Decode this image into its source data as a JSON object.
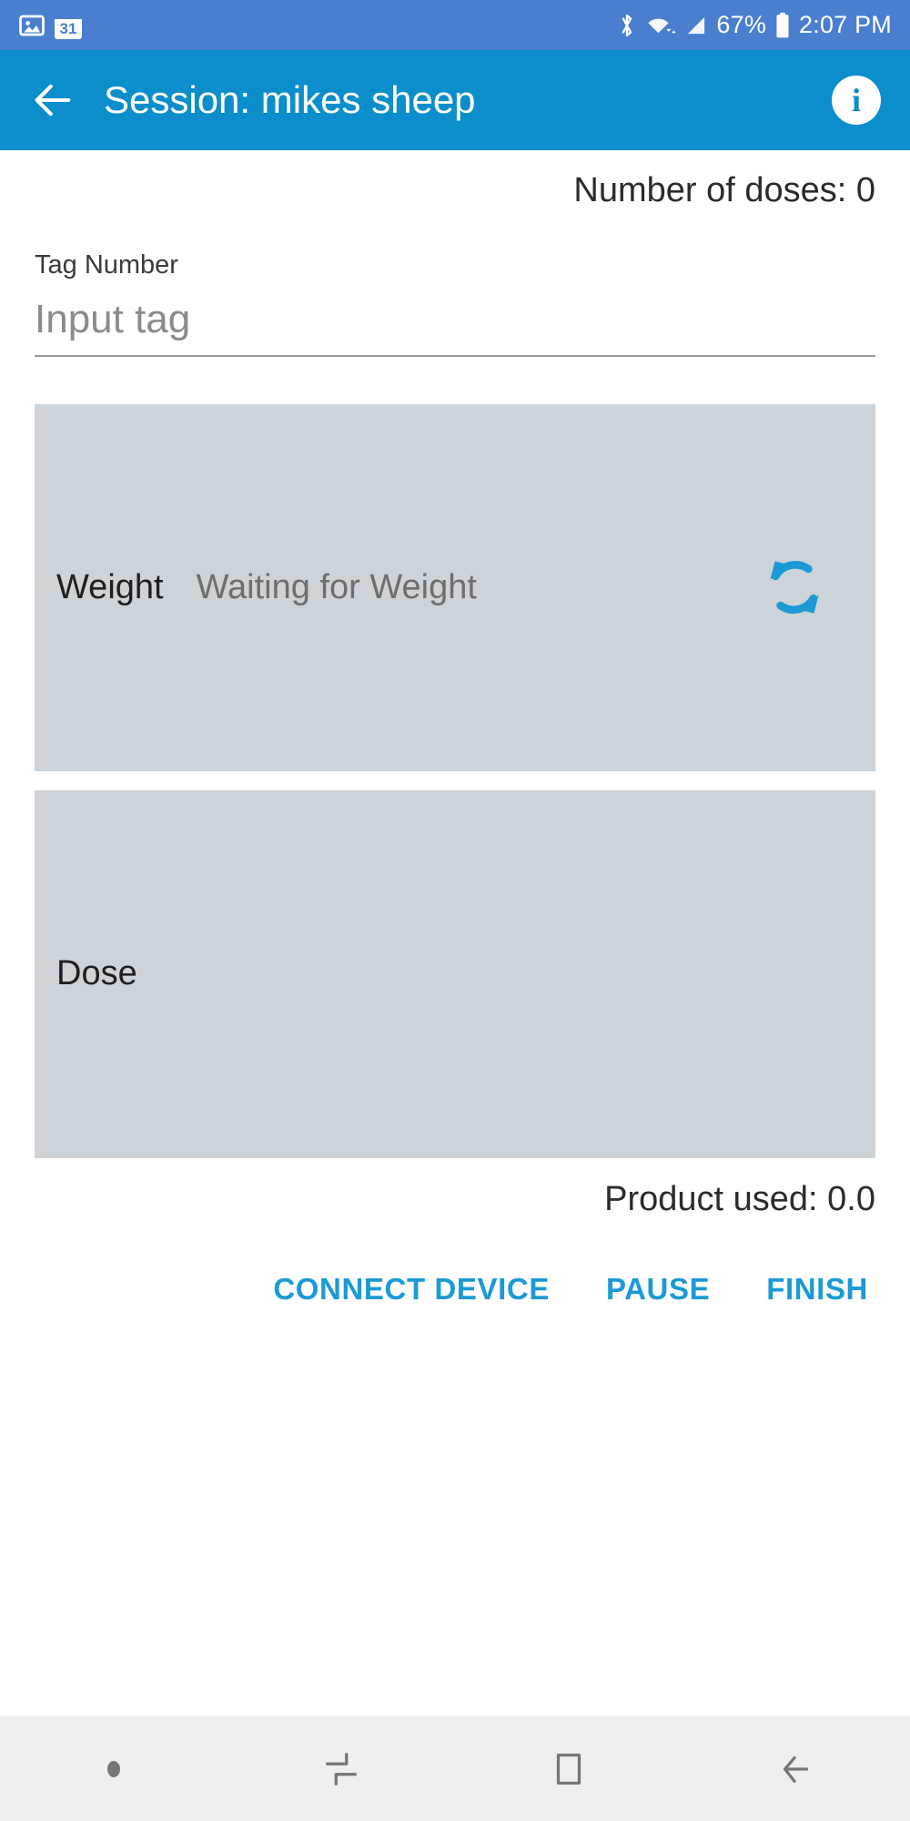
{
  "status_bar": {
    "left_icons": [
      "image-icon",
      "calendar-icon"
    ],
    "calendar_day": "31",
    "right_icons": [
      "bluetooth-icon",
      "wifi-icon",
      "cell-signal-icon",
      "battery-icon"
    ],
    "battery_percent": "67%",
    "time": "2:07 PM",
    "background_color": "#4a7fd0"
  },
  "app_bar": {
    "back_icon": "back-arrow-icon",
    "title": "Session: mikes sheep",
    "info_icon": "info-icon",
    "info_glyph": "i",
    "background_color": "#0b8ecb"
  },
  "main": {
    "doses_text": "Number of doses: 0",
    "tag_label": "Tag Number",
    "tag_value": "",
    "tag_placeholder": "Input tag",
    "weight_panel": {
      "label": "Weight",
      "status": "Waiting for Weight",
      "refresh_icon": "refresh-sync-icon",
      "panel_color": "#ccd3d9",
      "icon_color": "#1b9ad6"
    },
    "dose_panel": {
      "label": "Dose",
      "value": "",
      "panel_color": "#ccd3d9"
    },
    "product_used_text": "Product used: 0.0"
  },
  "actions": {
    "connect_device": "CONNECT DEVICE",
    "pause": "PAUSE",
    "finish": "FINISH",
    "accent_color": "#1b9ad6"
  },
  "nav_bar": {
    "items": [
      "menu-dot-icon",
      "recents-icon",
      "home-icon",
      "back-icon"
    ],
    "background_color": "#efefef"
  }
}
